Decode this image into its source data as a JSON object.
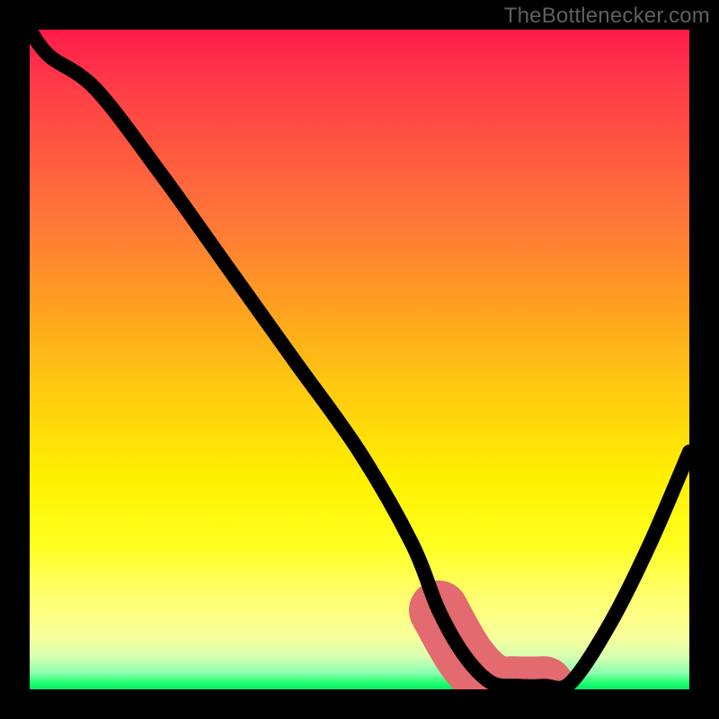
{
  "watermark": "TheBottlenecker.com",
  "chart_data": {
    "type": "line",
    "title": "",
    "xlabel": "",
    "ylabel": "",
    "xlim": [
      0,
      100
    ],
    "ylim": [
      0,
      100
    ],
    "gradient_stops": [
      {
        "pos": 0,
        "color": "#ff1a4a"
      },
      {
        "pos": 30,
        "color": "#ff7a38"
      },
      {
        "pos": 55,
        "color": "#ffcc10"
      },
      {
        "pos": 78,
        "color": "#ffff20"
      },
      {
        "pos": 95,
        "color": "#d8ffb0"
      },
      {
        "pos": 100,
        "color": "#00f060"
      }
    ],
    "series": [
      {
        "name": "bottleneck-curve",
        "x": [
          0,
          3,
          10,
          20,
          30,
          40,
          50,
          58,
          62,
          66,
          70,
          74,
          78,
          82,
          88,
          94,
          100
        ],
        "y": [
          100,
          96,
          91,
          78,
          64,
          50,
          36,
          22,
          12,
          5,
          1,
          0.5,
          0.5,
          1,
          10,
          22,
          36
        ]
      }
    ],
    "highlight_range_x": [
      62,
      80
    ],
    "annotations": []
  }
}
